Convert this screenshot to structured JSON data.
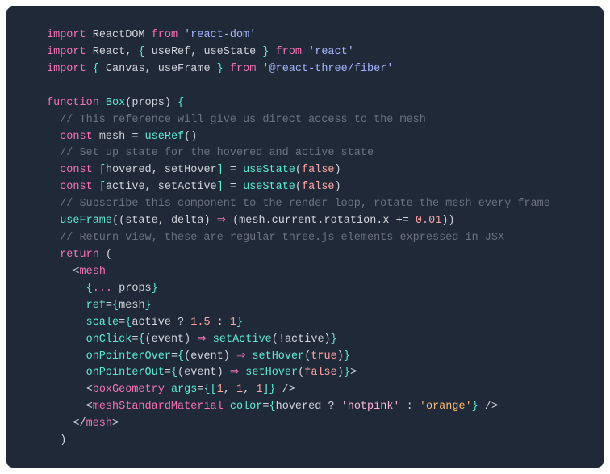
{
  "code": {
    "line1": {
      "import": "import",
      "ReactDOM": "ReactDOM",
      "from": "from",
      "str": "'react-dom'"
    },
    "line2": {
      "import": "import",
      "React": "React",
      "comma": ", ",
      "ob": "{",
      "useRef": "useRef",
      "c2": ", ",
      "useState": "useState",
      "cb": "}",
      "from": "from",
      "str": "'react'"
    },
    "line3": {
      "import": "import",
      "ob": "{",
      "Canvas": "Canvas",
      "c": ", ",
      "useFrame": "useFrame",
      "cb": "}",
      "from": "from",
      "str": "'@react-three/fiber'"
    },
    "line4": "",
    "line5": {
      "function": "function",
      "Box": "Box",
      "op": "(",
      "props": "props",
      "cp": ") ",
      "ob": "{"
    },
    "line6": {
      "cmt": "// This reference will give us direct access to the mesh"
    },
    "line7": {
      "const": "const",
      "mesh": "mesh",
      "eq": " = ",
      "useRef": "useRef",
      "par": "()"
    },
    "line8": {
      "cmt": "// Set up state for the hovered and active state"
    },
    "line9": {
      "const": "const",
      "ob": "[",
      "hovered": "hovered",
      "c": ", ",
      "setHover": "setHover",
      "cb": "]",
      "eq": " = ",
      "useState": "useState",
      "op": "(",
      "false": "false",
      "cp": ")"
    },
    "line10": {
      "const": "const",
      "ob": "[",
      "active": "active",
      "c": ", ",
      "setActive": "setActive",
      "cb": "]",
      "eq": " = ",
      "useState": "useState",
      "op": "(",
      "false": "false",
      "cp": ")"
    },
    "line11": {
      "cmt": "// Subscribe this component to the render-loop, rotate the mesh every frame"
    },
    "line12": {
      "useFrame": "useFrame",
      "op": "((",
      "state": "state",
      "c": ", ",
      "delta": "delta",
      "cp": ") ",
      "arrow": "⇒",
      "sp": " (",
      "expr": "mesh.current.rotation.x += ",
      "num": "0.01",
      "end": "))"
    },
    "line13": {
      "cmt": "// Return view, these are regular three.js elements expressed in JSX"
    },
    "line14": {
      "return": "return",
      " (": " ("
    },
    "line15": {
      "lt": "<",
      "tag": "mesh"
    },
    "line16": {
      "ob": "{",
      "spread": "...",
      "sp": " ",
      "props": "props",
      "cb": "}"
    },
    "line17": {
      "attr": "ref",
      "eq": "=",
      "ob": "{",
      "mesh": "mesh",
      "cb": "}"
    },
    "line18": {
      "attr": "scale",
      "eq": "=",
      "ob": "{",
      "active": "active",
      "q": " ? ",
      "n1": "1.5",
      "colon": " : ",
      "n2": "1",
      "cb": "}"
    },
    "line19": {
      "attr": "onClick",
      "eq": "=",
      "ob": "{",
      "op": "(",
      "event": "event",
      "cp": ") ",
      "arrow": "⇒",
      "sp": " ",
      "fn": "setActive",
      "op2": "(",
      "bang": "!",
      "active": "active",
      "cp2": ")",
      "cb": "}"
    },
    "line20": {
      "attr": "onPointerOver",
      "eq": "=",
      "ob": "{",
      "op": "(",
      "event": "event",
      "cp": ") ",
      "arrow": "⇒",
      "sp": " ",
      "fn": "setHover",
      "op2": "(",
      "true": "true",
      "cp2": ")",
      "cb": "}"
    },
    "line21": {
      "attr": "onPointerOut",
      "eq": "=",
      "ob": "{",
      "op": "(",
      "event": "event",
      "cp": ") ",
      "arrow": "⇒",
      "sp": " ",
      "fn": "setHover",
      "op2": "(",
      "false": "false",
      "cp2": ")",
      "cb": "}",
      "gt": ">"
    },
    "line22": {
      "lt": "<",
      "tag": "boxGeometry",
      "sp": " ",
      "attr": "args",
      "eq": "=",
      "ob": "{",
      "ob2": "[",
      "n1": "1",
      "c1": ", ",
      "n2": "1",
      "c2": ", ",
      "n3": "1",
      "cb2": "]",
      "cb": "}",
      "sp2": " ",
      "slash": "/>"
    },
    "line23": {
      "lt": "<",
      "tag": "meshStandardMaterial",
      "sp": " ",
      "attr": "color",
      "eq": "=",
      "ob": "{",
      "hovered": "hovered",
      "q": " ? ",
      "s1": "'hotpink'",
      "colon": " : ",
      "s2": "'orange'",
      "cb": "}",
      "sp2": " ",
      "slash": "/>"
    },
    "line24": {
      "lt": "</",
      "tag": "mesh",
      "gt": ">"
    },
    "line25": {
      "cp": ")"
    }
  }
}
